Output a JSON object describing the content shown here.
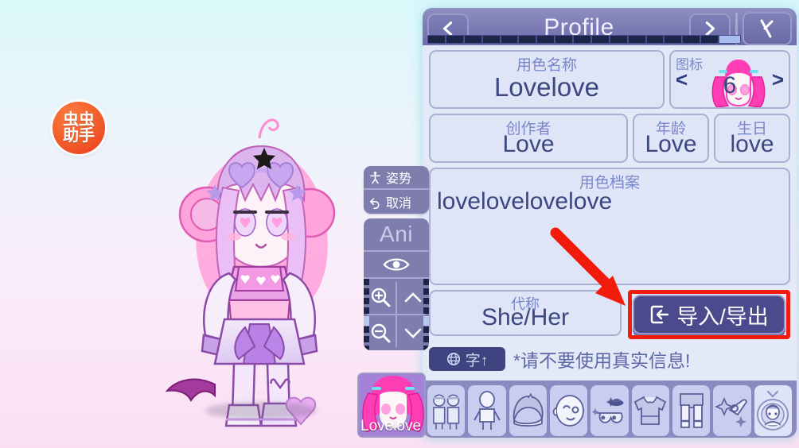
{
  "app": {
    "assistant_badge": {
      "line1": "虫虫",
      "line2": "助手"
    },
    "background_colors": {
      "top": "#d9f7fa",
      "bottom": "#fadff3"
    }
  },
  "panel": {
    "header": {
      "title": "Profile",
      "back_label": "<",
      "forward_label": ">",
      "close_label": "X",
      "progress_segments": 17,
      "progress_active_index": 17
    },
    "fields": {
      "name": {
        "label": "用色名称",
        "value": "Lovelove"
      },
      "avatar": {
        "label": "图标",
        "value": "6",
        "prev": "<",
        "next": ">"
      },
      "creator": {
        "label": "创作者",
        "value": "Love"
      },
      "age": {
        "label": "年龄",
        "value": "Love"
      },
      "birthday": {
        "label": "生日",
        "value": "love"
      },
      "description": {
        "label": "用色档案",
        "value": "lovelovelovelove"
      },
      "pronoun": {
        "label": "代称",
        "value": "She/Her"
      }
    },
    "import_export_button": {
      "label": "导入/导出",
      "icon": "import-export-icon",
      "highlighted": true,
      "highlight_color": "#f21b0c"
    },
    "language_button": {
      "label": "字↑",
      "icon": "globe-icon"
    },
    "warning_text": "*请不要使用真实信息!",
    "categories": [
      {
        "name": "preset-characters",
        "label": "预设"
      },
      {
        "name": "body",
        "label": "身体"
      },
      {
        "name": "hair",
        "label": "发型"
      },
      {
        "name": "face",
        "label": "脸部"
      },
      {
        "name": "accessories",
        "label": "饰品"
      },
      {
        "name": "tops",
        "label": "上衣"
      },
      {
        "name": "bottoms",
        "label": "下装"
      },
      {
        "name": "effects",
        "label": "特效"
      },
      {
        "name": "profile",
        "label": "档案"
      }
    ]
  },
  "tools": {
    "pose": {
      "label": "姿势",
      "icon": "pose-icon"
    },
    "cancel": {
      "label": "取消",
      "icon": "undo-icon"
    },
    "anim": {
      "label": "Ani"
    },
    "eye": {
      "icon": "eye-icon"
    },
    "zoom_in": {
      "icon": "zoom-in-icon"
    },
    "zoom_out": {
      "icon": "zoom-out-icon"
    },
    "up": {
      "icon": "chevron-up-icon"
    },
    "down": {
      "icon": "chevron-down-icon"
    }
  },
  "character_tab": {
    "label": "Lovelove"
  },
  "annotation": {
    "arrow_color": "#f21b0c",
    "points_to": "import-export-button"
  }
}
